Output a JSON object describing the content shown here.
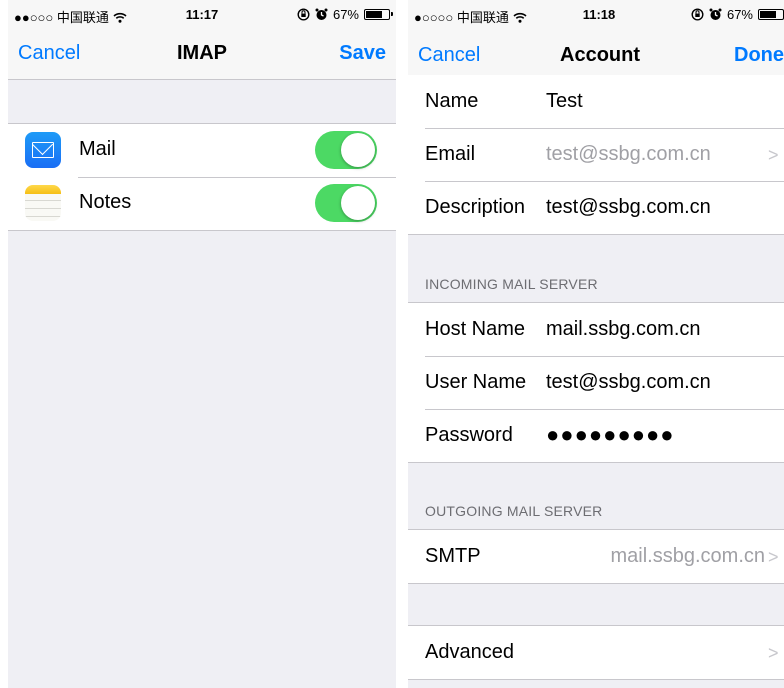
{
  "left_screen": {
    "status": {
      "signal": "●●○○○",
      "carrier": "中国联通",
      "time": "11:17",
      "battery_pct": "67%",
      "battery_level": 0.67
    },
    "nav": {
      "cancel": "Cancel",
      "title": "IMAP",
      "save": "Save"
    },
    "toggles": [
      {
        "label": "Mail",
        "on": true
      },
      {
        "label": "Notes",
        "on": true
      }
    ]
  },
  "right_screen": {
    "status": {
      "signal": "●○○○○",
      "carrier": "中国联通",
      "time": "11:18",
      "battery_pct": "67%",
      "battery_level": 0.67
    },
    "nav": {
      "cancel": "Cancel",
      "title": "Account",
      "done": "Done"
    },
    "account": {
      "name_label": "Name",
      "name_value": "Test",
      "email_label": "Email",
      "email_value": "test@ssbg.com.cn",
      "description_label": "Description",
      "description_value": "test@ssbg.com.cn"
    },
    "incoming": {
      "header": "INCOMING MAIL SERVER",
      "host_label": "Host Name",
      "host_value": "mail.ssbg.com.cn",
      "user_label": "User Name",
      "user_value": "test@ssbg.com.cn",
      "password_label": "Password",
      "password_value": "●●●●●●●●●"
    },
    "outgoing": {
      "header": "OUTGOING MAIL SERVER",
      "smtp_label": "SMTP",
      "smtp_value": "mail.ssbg.com.cn"
    },
    "advanced": {
      "label": "Advanced"
    }
  },
  "icons": [
    "wifi-icon",
    "orientation-lock-icon",
    "alarm-icon",
    "battery-icon",
    "mail-app-icon",
    "notes-app-icon",
    "chevron-right-icon"
  ],
  "colors": {
    "accent": "#007aff",
    "toggle_on": "#4cd964",
    "background": "#efeff4",
    "separator": "#c8c7cc"
  }
}
